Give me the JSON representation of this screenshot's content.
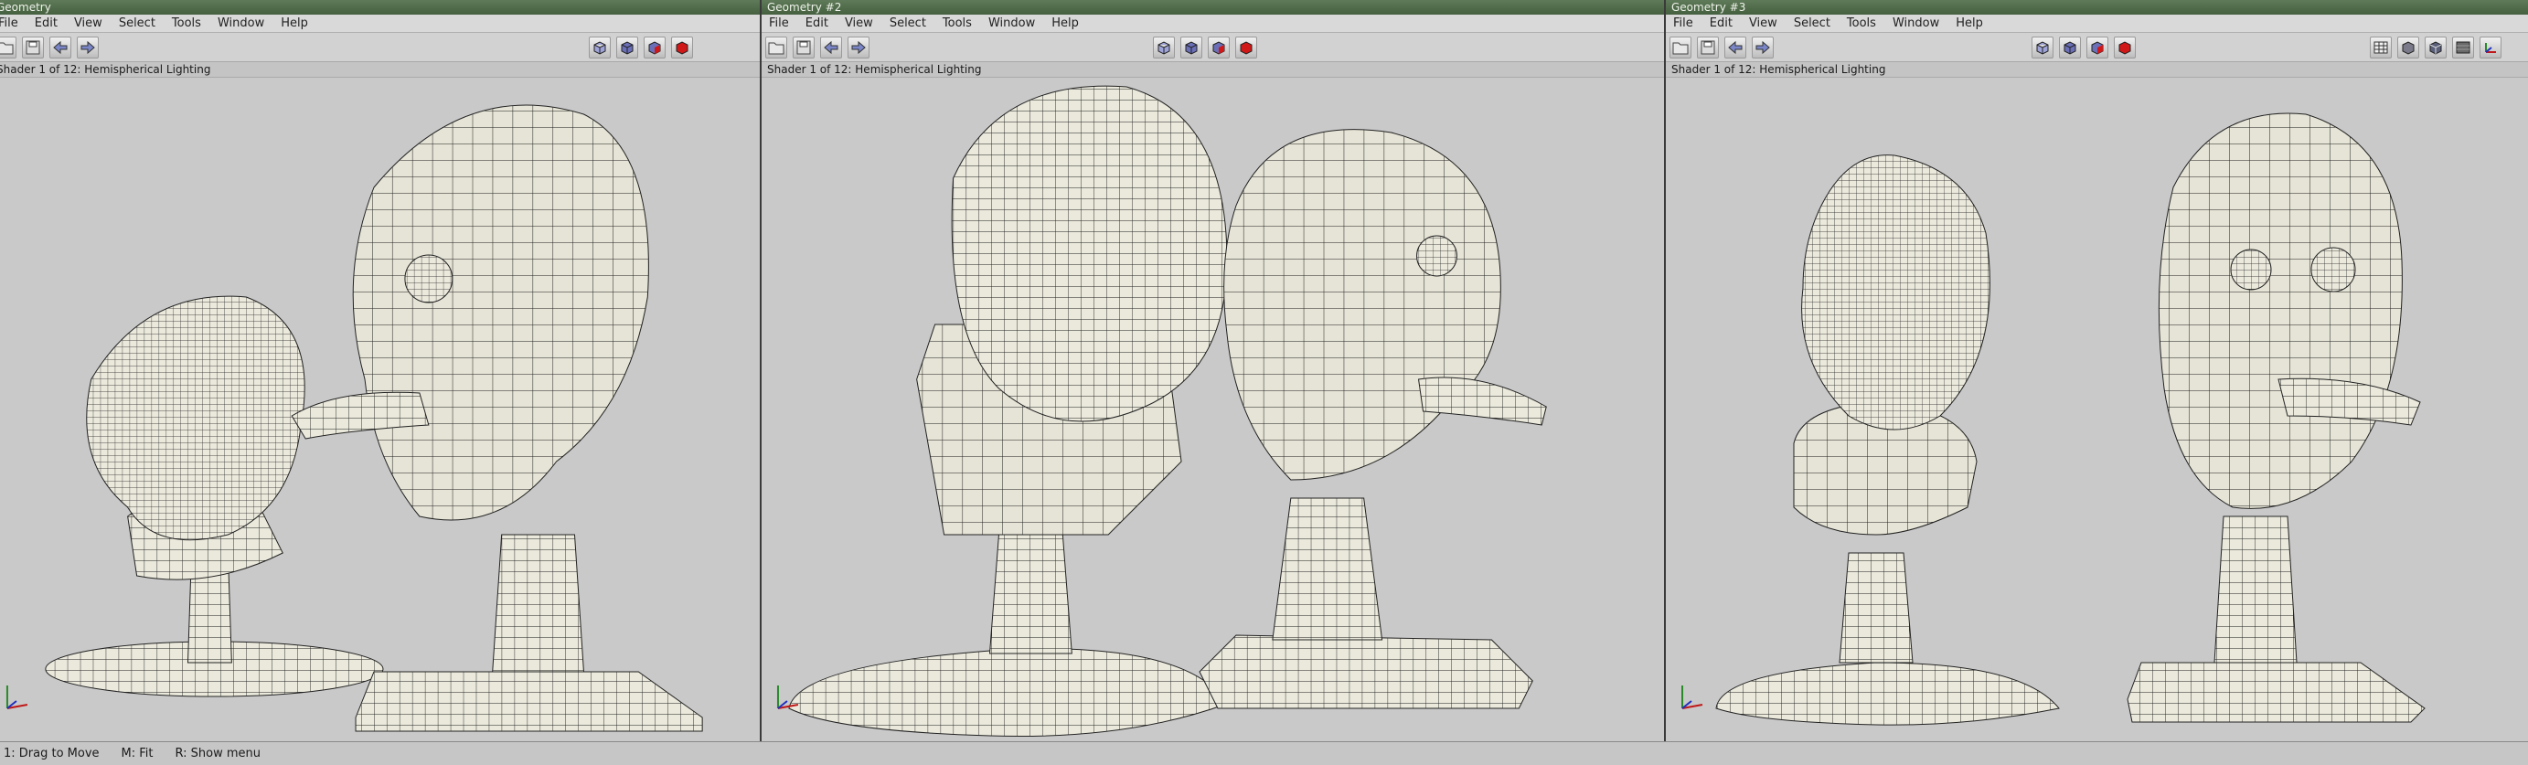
{
  "menus": [
    "File",
    "Edit",
    "View",
    "Select",
    "Tools",
    "Window",
    "Help"
  ],
  "windows": [
    {
      "title": "Geometry",
      "shader": "Shader 1 of 12: Hemispherical Lighting"
    },
    {
      "title": "Geometry #2",
      "shader": "Shader 1 of 12: Hemispherical Lighting"
    },
    {
      "title": "Geometry #3",
      "shader": "Shader 1 of 12: Hemispherical Lighting"
    }
  ],
  "status_hints": [
    "1: Drag to Move",
    "M: Fit",
    "R: Show menu"
  ],
  "colors": {
    "title_bar": "#4f6b49",
    "viewport_bg": "#c9c9c9",
    "mesh_fill": "#ebe9dc",
    "mesh_lines": "#1e1e1e",
    "red_cube": "#d01818",
    "blue_cube": "#6a6fb8"
  },
  "toolbar_icons_left": [
    "open-folder-icon",
    "save-disk-icon",
    "arrow-left-icon",
    "arrow-right-icon"
  ],
  "toolbar_icons_right": [
    "wireframe-cube-icon",
    "shaded-cube-icon",
    "shaded-wire-cube-icon",
    "red-cube-icon"
  ],
  "toolbar_icons_extra": [
    "grid-icon",
    "cube-icon",
    "cube-faces-icon",
    "texture-icon",
    "axes-icon"
  ]
}
